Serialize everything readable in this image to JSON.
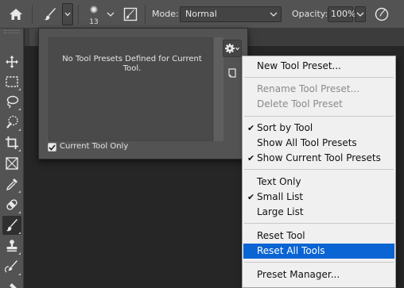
{
  "options_bar": {
    "brush_size": "13",
    "mode_label": "Mode:",
    "mode_value": "Normal",
    "opacity_label": "Opacity:",
    "opacity_value": "100%"
  },
  "presets_panel": {
    "empty_message": "No Tool Presets Defined for Current Tool.",
    "current_tool_only_label": "Current Tool Only",
    "current_tool_only_checked": true
  },
  "menu": {
    "items": [
      {
        "label": "New Tool Preset...",
        "enabled": true,
        "checked": false
      },
      {
        "label": "Rename Tool Preset...",
        "enabled": false,
        "checked": false
      },
      {
        "label": "Delete Tool Preset",
        "enabled": false,
        "checked": false
      },
      {
        "label": "Sort by Tool",
        "enabled": true,
        "checked": true
      },
      {
        "label": "Show All Tool Presets",
        "enabled": true,
        "checked": false
      },
      {
        "label": "Show Current Tool Presets",
        "enabled": true,
        "checked": true
      },
      {
        "label": "Text Only",
        "enabled": true,
        "checked": false
      },
      {
        "label": "Small List",
        "enabled": true,
        "checked": true
      },
      {
        "label": "Large List",
        "enabled": true,
        "checked": false
      },
      {
        "label": "Reset Tool",
        "enabled": true,
        "checked": false
      },
      {
        "label": "Reset All Tools",
        "enabled": true,
        "checked": false,
        "highlighted": true
      },
      {
        "label": "Preset Manager...",
        "enabled": true,
        "checked": false
      }
    ],
    "check_glyph": "✔",
    "highlight_color": "#0a64d3"
  },
  "toolbar": {
    "tools": [
      "move-tool-icon",
      "marquee-tool-icon",
      "lasso-tool-icon",
      "quick-select-tool-icon",
      "crop-tool-icon",
      "frame-tool-icon",
      "eyedropper-tool-icon",
      "healing-brush-tool-icon",
      "brush-tool-icon",
      "clone-stamp-tool-icon",
      "history-brush-tool-icon"
    ],
    "active_tool": "brush-tool-icon"
  }
}
